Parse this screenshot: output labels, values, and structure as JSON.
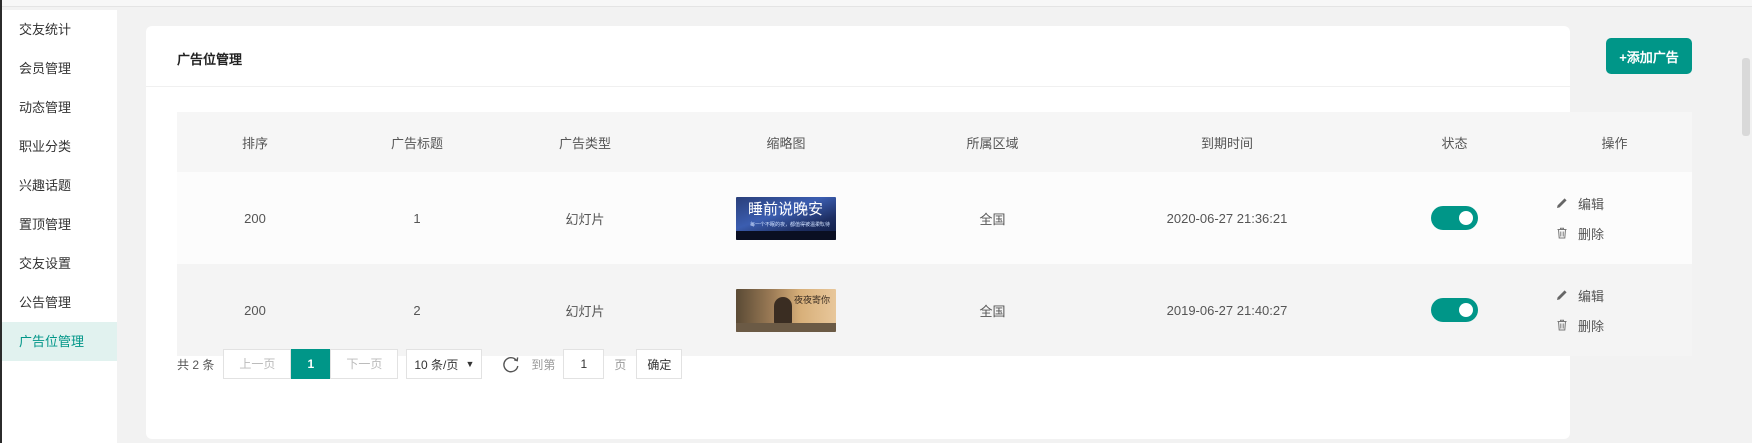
{
  "sidebar": {
    "items": [
      {
        "label": "交友统计"
      },
      {
        "label": "会员管理"
      },
      {
        "label": "动态管理"
      },
      {
        "label": "职业分类"
      },
      {
        "label": "兴趣话题"
      },
      {
        "label": "置顶管理"
      },
      {
        "label": "交友设置"
      },
      {
        "label": "公告管理"
      },
      {
        "label": "广告位管理",
        "active": true
      }
    ]
  },
  "panel": {
    "title": "广告位管理",
    "add_button": "+添加广告"
  },
  "table": {
    "headers": [
      "排序",
      "广告标题",
      "广告类型",
      "缩略图",
      "所属区域",
      "到期时间",
      "状态",
      "操作"
    ],
    "rows": [
      {
        "sort": "200",
        "title": "1",
        "type": "幻灯片",
        "thumb_text": "睡前说晚安",
        "thumb_sub": "每一个不眠的夜，都值得被温柔以待",
        "region": "全国",
        "expire": "2020-06-27 21:36:21",
        "status_on": true,
        "edit": "编辑",
        "delete": "删除"
      },
      {
        "sort": "200",
        "title": "2",
        "type": "幻灯片",
        "thumb_text": "夜夜寄你",
        "thumb_sub": "",
        "region": "全国",
        "expire": "2019-06-27 21:40:27",
        "status_on": true,
        "edit": "编辑",
        "delete": "删除"
      }
    ]
  },
  "pager": {
    "total": "共 2 条",
    "prev": "上一页",
    "current": "1",
    "next": "下一页",
    "page_size": "10 条/页",
    "goto_label": "到第",
    "goto_value": "1",
    "page_unit": "页",
    "confirm": "确定"
  },
  "colors": {
    "accent": "#009688",
    "active_bg": "#e1f2ef"
  },
  "icons": {
    "edit": "pencil-icon",
    "delete": "trash-icon",
    "refresh": "refresh-icon",
    "dropdown": "caret-down-icon"
  }
}
